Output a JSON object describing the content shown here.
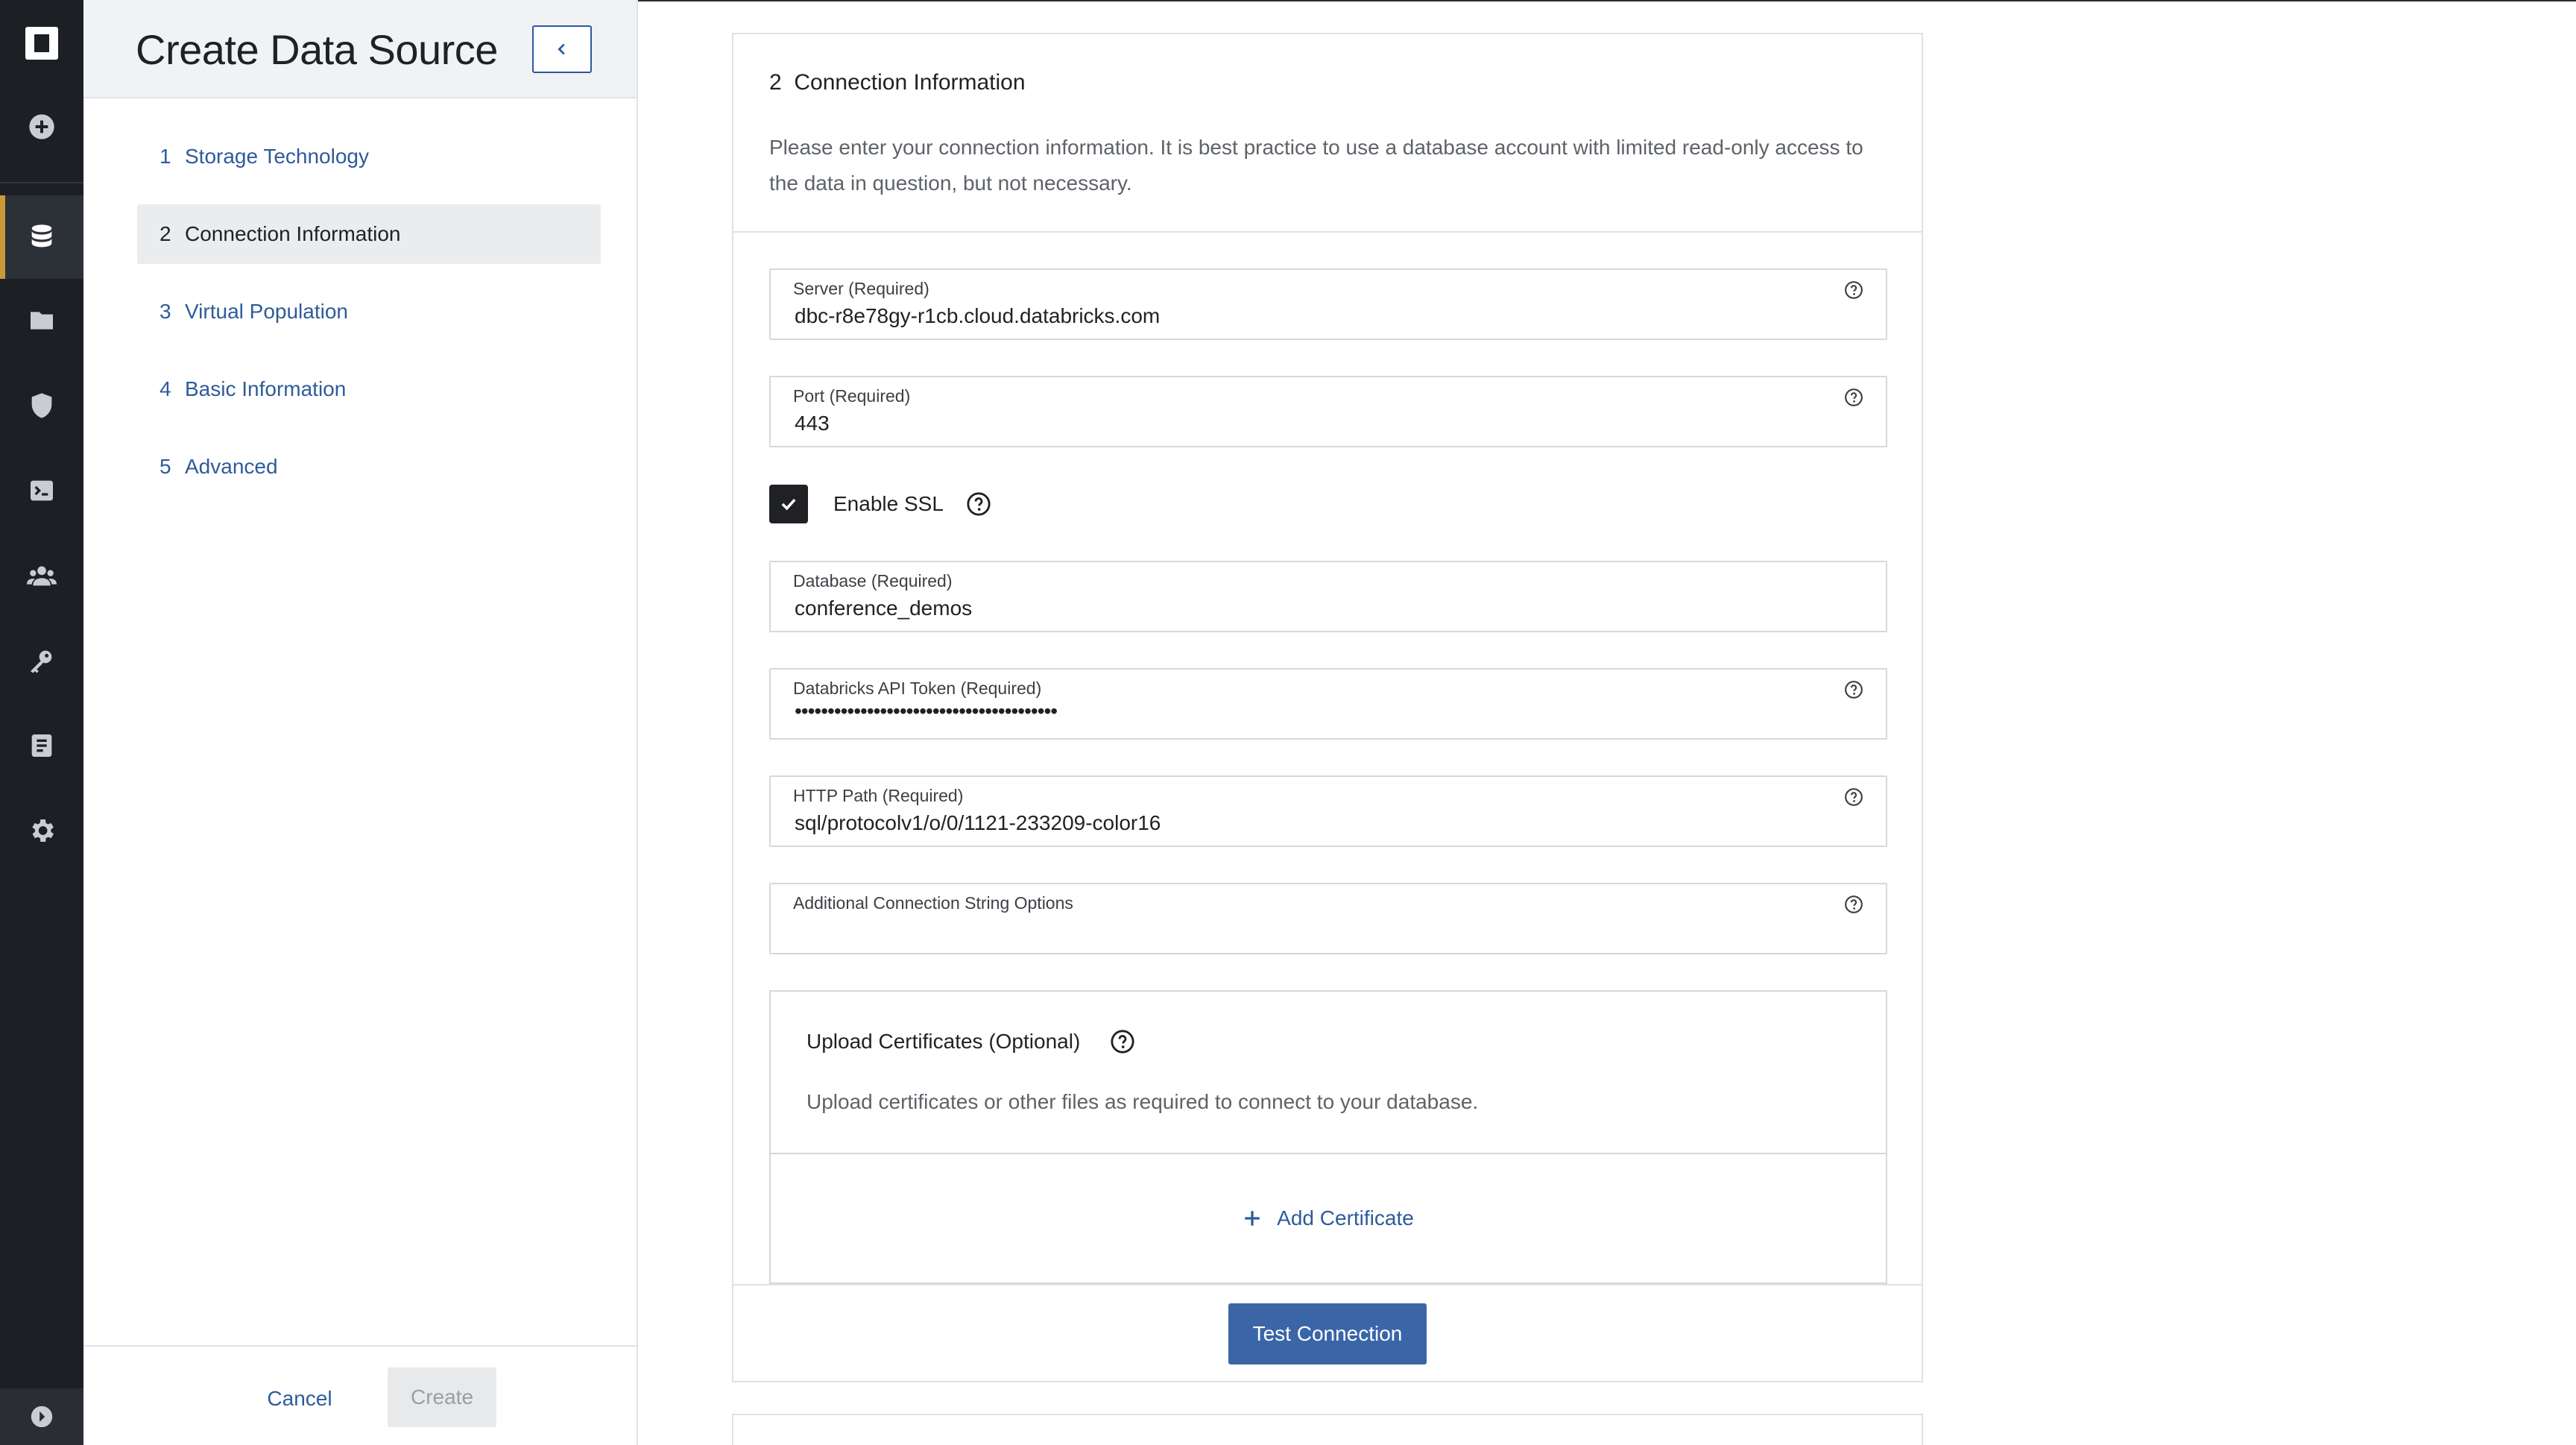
{
  "wizard": {
    "title": "Create Data Source",
    "steps": [
      {
        "num": "1",
        "label": "Storage Technology"
      },
      {
        "num": "2",
        "label": "Connection Information"
      },
      {
        "num": "3",
        "label": "Virtual Population"
      },
      {
        "num": "4",
        "label": "Basic Information"
      },
      {
        "num": "5",
        "label": "Advanced"
      }
    ],
    "cancel_label": "Cancel",
    "create_label": "Create"
  },
  "rail": {
    "icons": [
      "logo-icon",
      "add-icon",
      "database-icon",
      "folder-icon",
      "shield-icon",
      "terminal-icon",
      "people-icon",
      "key-icon",
      "document-icon",
      "gear-icon",
      "expand-icon"
    ],
    "accent_color": "#c99a3a"
  },
  "section": {
    "number": "2",
    "title": "Connection Information",
    "description": "Please enter your connection information. It is best practice to use a database account with limited read-only access to the data in question, but not necessary."
  },
  "fields": {
    "server": {
      "label": "Server (Required)",
      "value": "dbc-r8e78gy-r1cb.cloud.databricks.com"
    },
    "port": {
      "label": "Port (Required)",
      "value": "443"
    },
    "database": {
      "label": "Database (Required)",
      "value": "conference_demos"
    },
    "token": {
      "label": "Databricks API Token (Required)",
      "value": "••••••••••••••••••••••••••••••••••••••••"
    },
    "http_path": {
      "label": "HTTP Path (Required)",
      "value": "sql/protocolv1/o/0/1121-233209-color16"
    },
    "additional": {
      "label": "Additional Connection String Options",
      "value": ""
    }
  },
  "ssl": {
    "label": "Enable SSL",
    "checked": true
  },
  "upload": {
    "title": "Upload Certificates (Optional)",
    "description": "Upload certificates or other files as required to connect to your database.",
    "add_label": "Add Certificate"
  },
  "actions": {
    "test_label": "Test Connection"
  },
  "colors": {
    "primary": "#3a66a8",
    "link": "#2e5b9a",
    "rail": "#1c1f24"
  }
}
